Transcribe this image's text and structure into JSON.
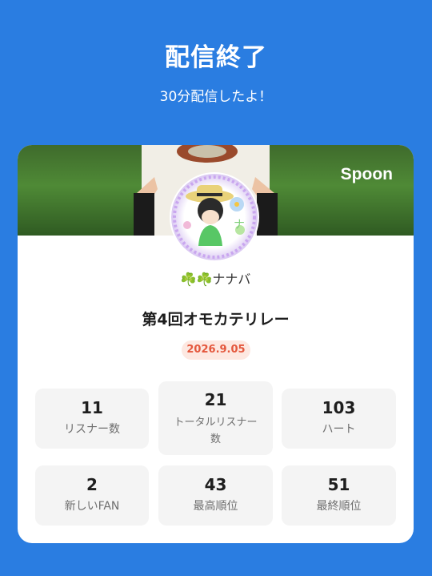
{
  "header": {
    "title": "配信終了",
    "subtitle": "30分配信したよ！"
  },
  "card": {
    "brand": "Spoon",
    "username": "☘️☘️ナナバ",
    "event_title": "第4回オモカテリレー",
    "date": "2026.9.05",
    "colors": {
      "background": "#2a7de1",
      "date_text": "#e4573c",
      "date_bg": "#fde8e1"
    }
  },
  "stats": [
    {
      "value": "11",
      "label": "リスナー数"
    },
    {
      "value": "21",
      "label": "トータルリスナー数"
    },
    {
      "value": "103",
      "label": "ハート"
    },
    {
      "value": "2",
      "label": "新しいFAN"
    },
    {
      "value": "43",
      "label": "最高順位"
    },
    {
      "value": "51",
      "label": "最終順位"
    }
  ]
}
